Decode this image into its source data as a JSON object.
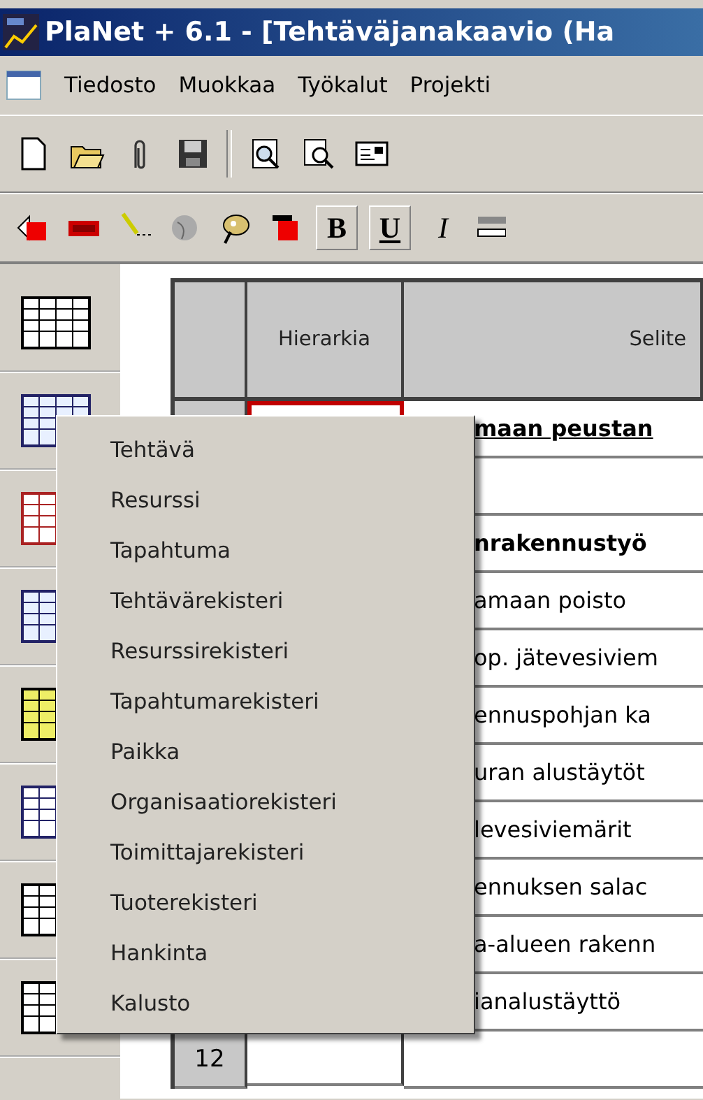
{
  "window": {
    "title": "PlaNet + 6.1 - [Tehtäväjanakaavio (Ha"
  },
  "menu_bar": [
    "Tiedosto",
    "Muokkaa",
    "Työkalut",
    "Projekti"
  ],
  "format_buttons": [
    "B",
    "U",
    "I"
  ],
  "table": {
    "columns": [
      "Hierarkia",
      "Selite"
    ],
    "rows": [
      {
        "hierarchy_selected": true,
        "text": "maan peustan",
        "bold": true,
        "underlined": true
      },
      {
        "text": ""
      },
      {
        "text": "nrakennustyö",
        "bold": true,
        "underlined": false
      },
      {
        "text": "amaan poisto",
        "bold": false,
        "underlined": false
      },
      {
        "text": "op. jätevesiviem",
        "bold": false,
        "underlined": false
      },
      {
        "text": "ennuspohjan ka",
        "bold": false,
        "underlined": false
      },
      {
        "text": "uran alustäytöt",
        "bold": false,
        "underlined": false
      },
      {
        "text": "levesiviemärit",
        "bold": false,
        "underlined": false
      },
      {
        "text": "ennuksen salac",
        "bold": false,
        "underlined": false
      },
      {
        "text": "a-alueen rakenn",
        "bold": false,
        "underlined": false
      },
      {
        "text": "ianalustäyttö",
        "bold": false,
        "underlined": false
      },
      {
        "number": "12",
        "hierarchy_selected": false,
        "text": ""
      }
    ]
  },
  "context_menu": [
    "Tehtävä",
    "Resurssi",
    "Tapahtuma",
    "Tehtävärekisteri",
    "Resurssirekisteri",
    "Tapahtumarekisteri",
    "Paikka",
    "Organisaatiorekisteri",
    "Toimittajarekisteri",
    "Tuoterekisteri",
    "Hankinta",
    "Kalusto"
  ]
}
